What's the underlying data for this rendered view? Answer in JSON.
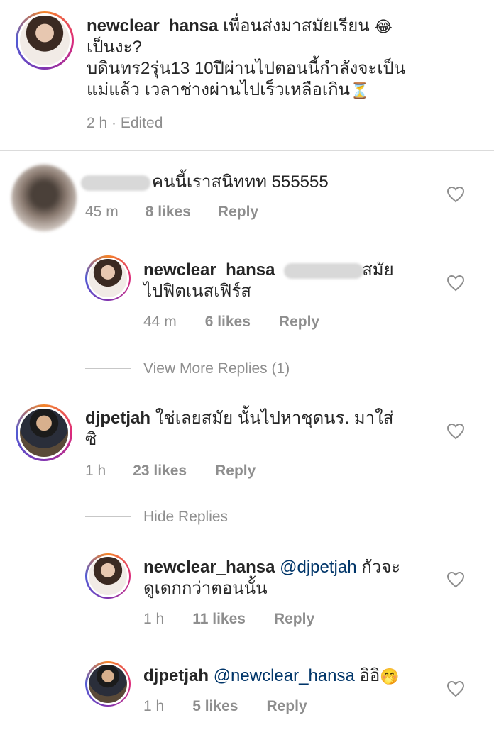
{
  "caption": {
    "username": "newclear_hansa",
    "text_line1": "เพื่อนส่งมาสมัยเรียน",
    "text_line2": "เป็นงะ?",
    "text_line3": " บดินทร2รุ่น13  10ปีผ่านไปตอนนี้กำลังจะเป็น",
    "text_line4": "แม่แล้ว เวลาช่างผ่านไปเร็วเหลือเกิน",
    "emoji1": "😂",
    "emoji2": "⏳",
    "time": "2 h",
    "edited": "· Edited"
  },
  "comments": [
    {
      "id": "c1",
      "text": "คนนี้เราสนิททท 555555",
      "time": "45 m",
      "likes": "8 likes",
      "reply": "Reply"
    },
    {
      "id": "r1",
      "username": "newclear_hansa",
      "text_after_blur": "สมัย",
      "text_line2": "ไปฟิตเนสเฟิร์ส",
      "time": "44 m",
      "likes": "6 likes",
      "reply": "Reply"
    },
    {
      "id": "c2",
      "username": "djpetjah",
      "text_line1": "ใช่เลยสมัย นั้นไปหาชุดนร. มาใส่",
      "text_line2": "ซิ",
      "time": "1 h",
      "likes": "23 likes",
      "reply": "Reply"
    },
    {
      "id": "r2",
      "username": "newclear_hansa",
      "mention": "@djpetjah",
      "text_line1": "กัวจะ",
      "text_line2": "ดูเดกกว่าตอนนั้น",
      "time": "1 h",
      "likes": "11 likes",
      "reply": "Reply"
    },
    {
      "id": "r3",
      "username": "djpetjah",
      "mention": "@newclear_hansa",
      "text": "อิอิ",
      "emoji": "🤭",
      "time": "1 h",
      "likes": "5 likes",
      "reply": "Reply"
    }
  ],
  "toggles": {
    "view_more": "View More Replies (1)",
    "hide": "Hide Replies"
  },
  "icons": {
    "like": "heart-outline-icon"
  },
  "colors": {
    "text": "#262626",
    "muted": "#8e8e8e",
    "mention": "#003569"
  }
}
